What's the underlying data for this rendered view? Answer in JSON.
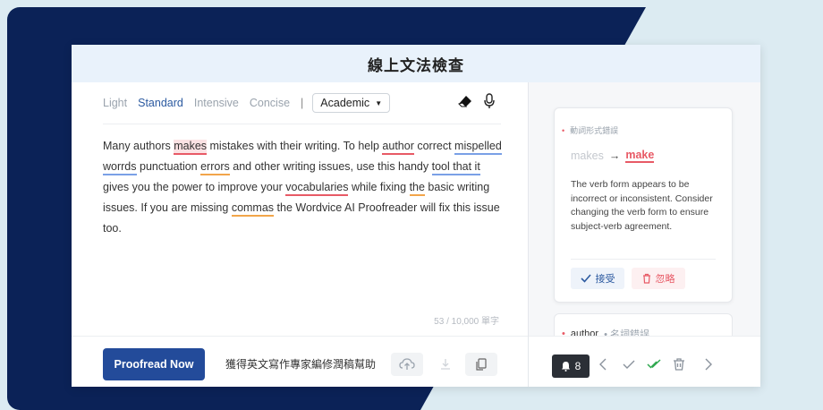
{
  "header": {
    "title": "線上文法檢查"
  },
  "modes": [
    "Light",
    "Standard",
    "Intensive",
    "Concise"
  ],
  "active_mode": "Standard",
  "separator": "|",
  "style_select": {
    "value": "Academic"
  },
  "editor": {
    "segments": [
      {
        "text": "Many authors ",
        "err": ""
      },
      {
        "text": "makes",
        "err": "red-hl"
      },
      {
        "text": " mistakes with their writing. To help ",
        "err": ""
      },
      {
        "text": "author",
        "err": "red"
      },
      {
        "text": " correct ",
        "err": ""
      },
      {
        "text": "mispelled worrds",
        "err": "blue"
      },
      {
        "text": " punctuation ",
        "err": ""
      },
      {
        "text": "errors",
        "err": "orange"
      },
      {
        "text": " and other writing issues, use this handy ",
        "err": ""
      },
      {
        "text": "tool that it",
        "err": "blue"
      },
      {
        "text": " gives you the power to improve your ",
        "err": ""
      },
      {
        "text": "vocabularies",
        "err": "red"
      },
      {
        "text": " while fixing ",
        "err": ""
      },
      {
        "text": "the",
        "err": "orange"
      },
      {
        "text": " basic writing issues. If you are missing ",
        "err": ""
      },
      {
        "text": "commas",
        "err": "orange"
      },
      {
        "text": " the Wordvice AI Proofreader will fix this issue too.",
        "err": ""
      }
    ],
    "counter": "53 / 10,000 單字"
  },
  "bottom": {
    "proofread_label": "Proofread Now",
    "promo_text": "獲得英文寫作專家編修潤稿幫助"
  },
  "suggestion": {
    "category": "動詞形式錯誤",
    "original": "makes",
    "arrow": "→",
    "replacement": "make",
    "description": "The verb form appears to be incorrect or inconsistent. Consider changing the verb form to ensure subject-verb agreement.",
    "accept_label": "接受",
    "ignore_label": "忽略"
  },
  "next_suggestion": {
    "word": "author",
    "category": "名詞錯誤"
  },
  "issues": {
    "count": "8"
  },
  "colors": {
    "navy": "#0b2257",
    "accent": "#234b9a",
    "error_red": "#e85a66",
    "warn_orange": "#f2a54a",
    "style_blue": "#7aa0e6",
    "check_green": "#2fa84f"
  }
}
